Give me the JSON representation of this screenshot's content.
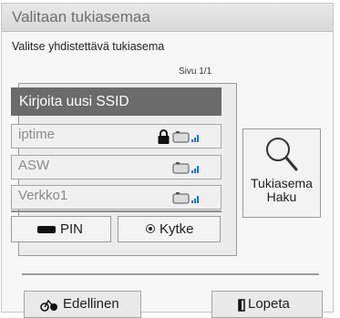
{
  "dialog": {
    "title": "Valitaan tukiasemaa",
    "subtitle": "Valitse yhdistettävä tukiasema",
    "page_indicator": "Sivu 1/1"
  },
  "ap_list": {
    "new_ssid_label": "Kirjoita uusi SSID",
    "items": [
      {
        "name": "iptime",
        "locked": true,
        "icon": "wifi-signal-icon"
      },
      {
        "name": "ASW",
        "locked": false,
        "icon": "wifi-signal-icon"
      },
      {
        "name": "Verkko1",
        "locked": false,
        "icon": "wifi-signal-icon"
      }
    ]
  },
  "actions": {
    "pin_label": "PIN",
    "connect_label": "Kytke",
    "search_label_line1": "Tukiasema",
    "search_label_line2": "Haku"
  },
  "footer": {
    "previous_label": "Edellinen",
    "exit_label": "Lopeta"
  },
  "colors": {
    "selected_row": "#6b6b6b",
    "signal_accent": "#1a6fd1",
    "background": "#f7f7f7"
  }
}
